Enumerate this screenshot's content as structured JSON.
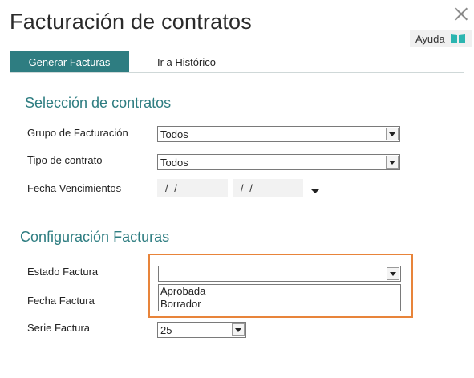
{
  "window": {
    "title": "Facturación de contratos"
  },
  "help": {
    "label": "Ayuda",
    "icon": "book-icon",
    "icon_color": "#2bb5b0"
  },
  "tabs": [
    {
      "label": "Generar Facturas",
      "active": true
    },
    {
      "label": "Ir a Histórico",
      "active": false
    }
  ],
  "accent": "#2e7d81",
  "highlight_color": "#e8843a",
  "seleccion": {
    "title": "Selección de contratos",
    "grupo": {
      "label": "Grupo de Facturación",
      "value": "Todos"
    },
    "tipo": {
      "label": "Tipo de contrato",
      "value": "Todos"
    },
    "fecha": {
      "label": "Fecha Vencimientos",
      "from": "/ /",
      "to": "/ /"
    }
  },
  "configuracion": {
    "title": "Configuración Facturas",
    "estado": {
      "label": "Estado Factura",
      "value": "",
      "options": [
        "Aprobada",
        "Borrador"
      ]
    },
    "fecha": {
      "label": "Fecha Factura"
    },
    "serie": {
      "label": "Serie Factura",
      "value": "25"
    }
  }
}
